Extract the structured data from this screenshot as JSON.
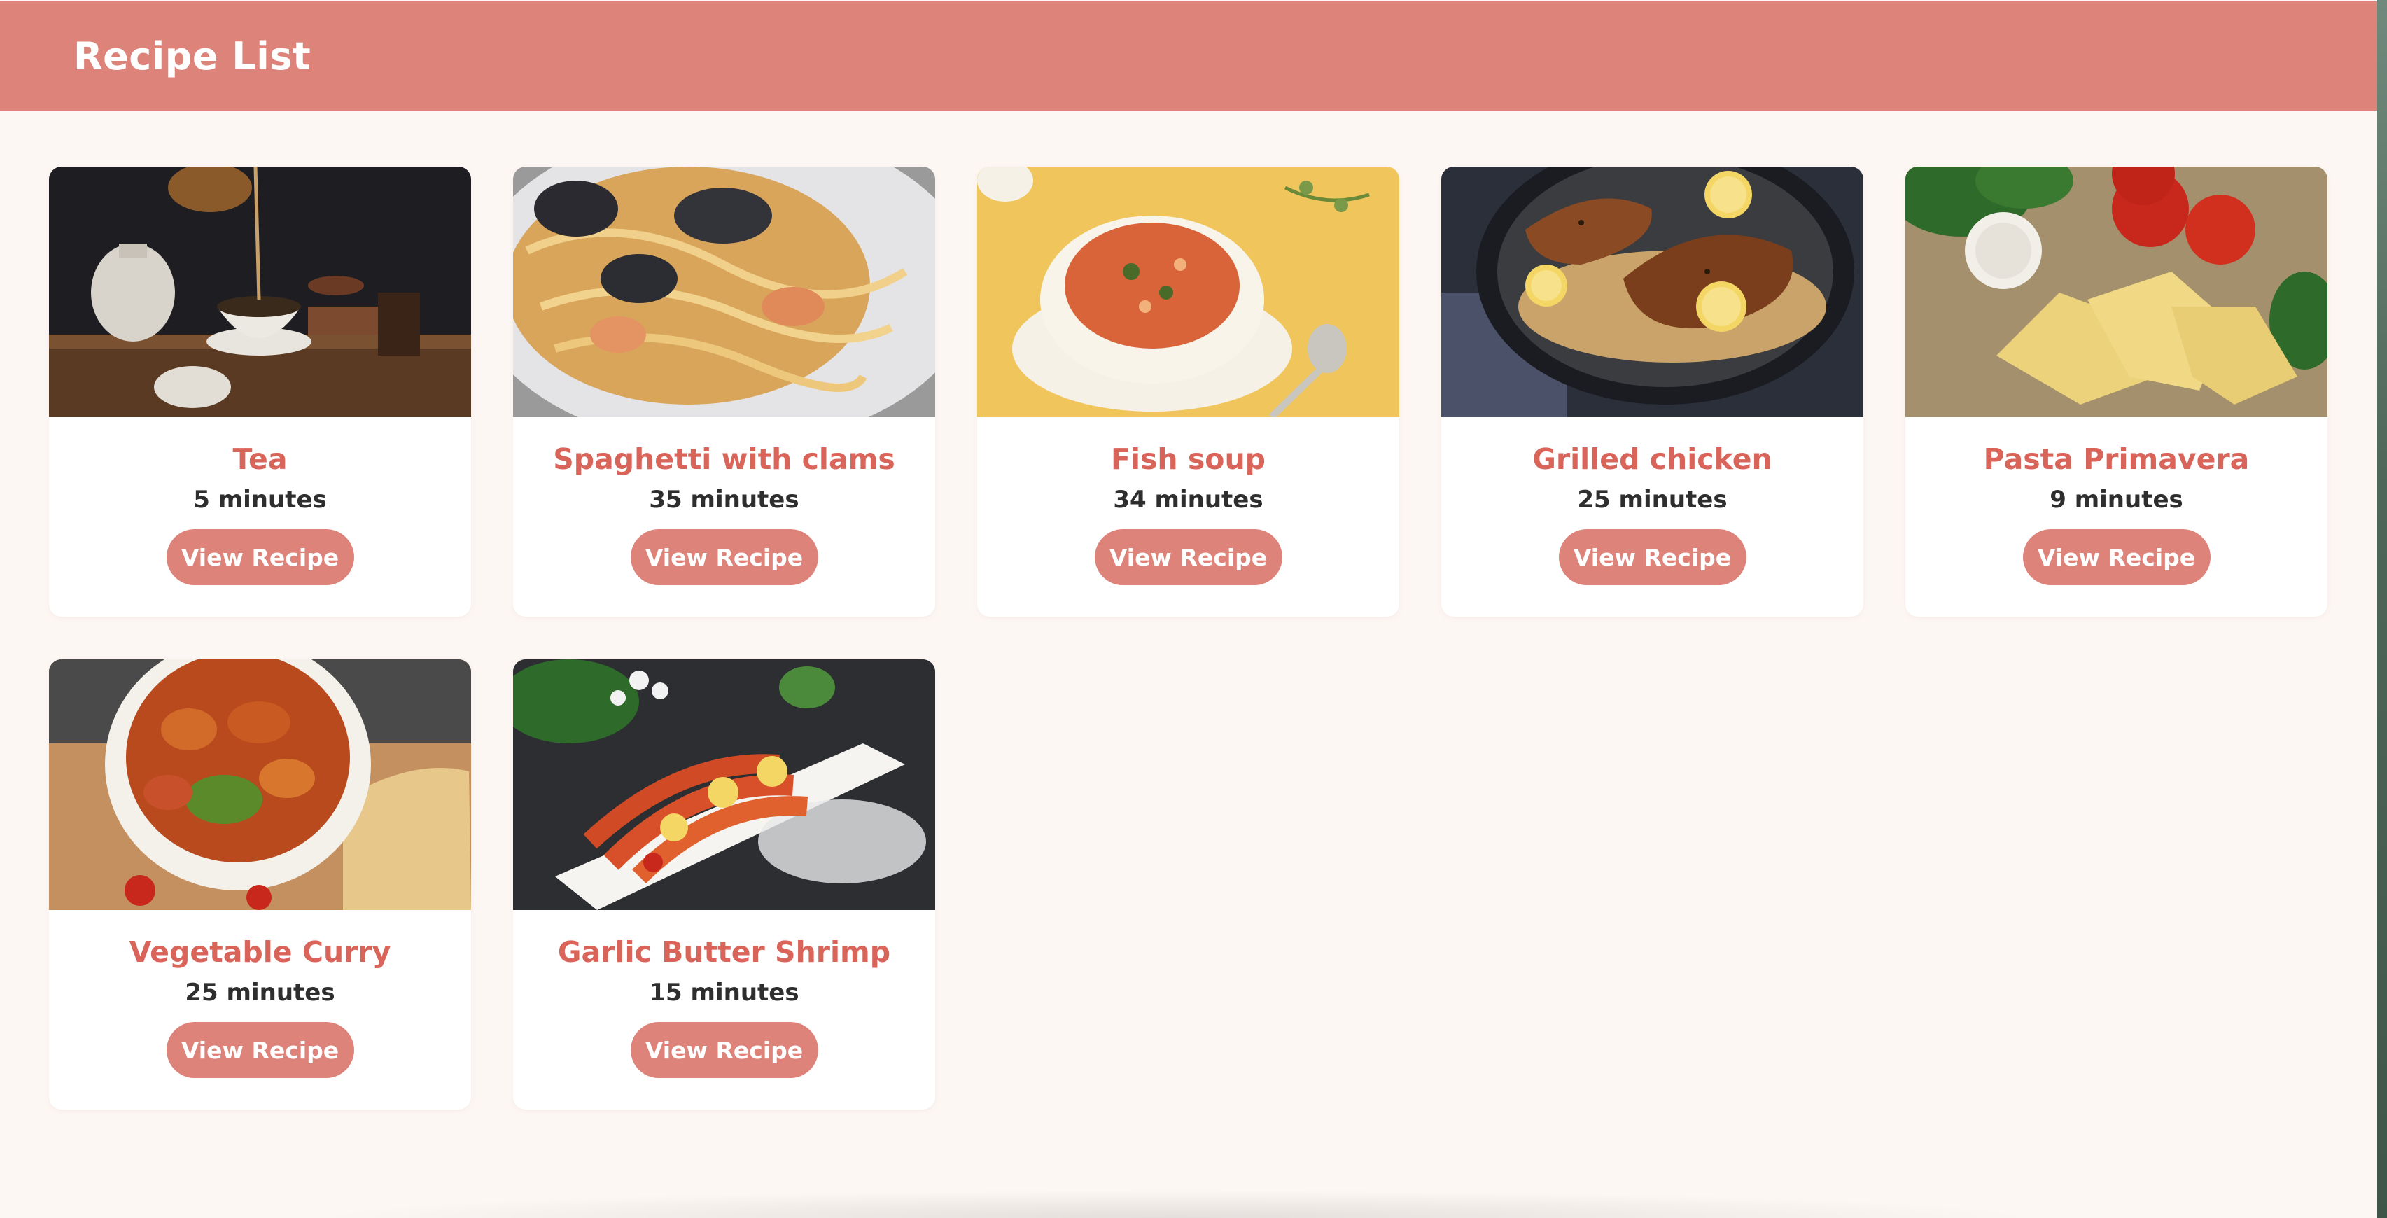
{
  "header": {
    "title": "Recipe List"
  },
  "recipes": [
    {
      "name": "Tea",
      "time": "5 minutes",
      "button": "View Recipe",
      "image": "tea-pouring-photo"
    },
    {
      "name": "Spaghetti with clams",
      "time": "35 minutes",
      "button": "View Recipe",
      "image": "spaghetti-clams-photo"
    },
    {
      "name": "Fish soup",
      "time": "34 minutes",
      "button": "View Recipe",
      "image": "fish-soup-photo"
    },
    {
      "name": "Grilled chicken",
      "time": "25 minutes",
      "button": "View Recipe",
      "image": "grilled-chicken-photo"
    },
    {
      "name": "Pasta Primavera",
      "time": "9 minutes",
      "button": "View Recipe",
      "image": "pasta-primavera-photo"
    },
    {
      "name": "Vegetable Curry",
      "time": "25 minutes",
      "button": "View Recipe",
      "image": "vegetable-curry-photo"
    },
    {
      "name": "Garlic Butter Shrimp",
      "time": "15 minutes",
      "button": "View Recipe",
      "image": "garlic-shrimp-photo"
    }
  ],
  "colors": {
    "accent": "#dd837a",
    "title": "#d9645a",
    "background": "#fdf7f4",
    "card": "#ffffff"
  }
}
